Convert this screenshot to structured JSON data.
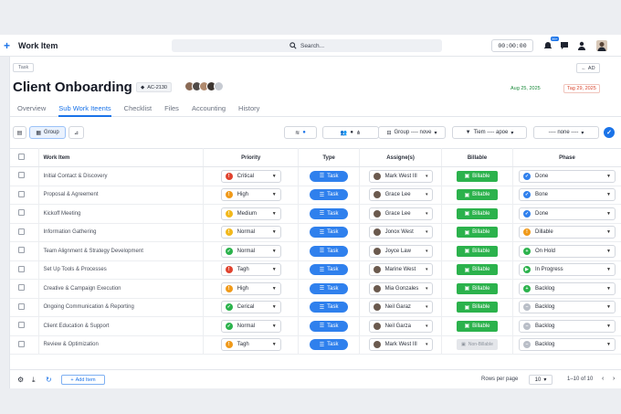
{
  "topbar": {
    "plus_label": "+",
    "title": "Work Item",
    "search_placeholder": "Search...",
    "timer": "00:00:00",
    "notification_badge": "99+"
  },
  "header": {
    "crumb": "Task",
    "title": "Client Onboarding",
    "id": "AC-2130",
    "ad_label": "AD",
    "start_date": "Aug 25, 2025",
    "end_date": "Tag 29, 2025"
  },
  "tabs": [
    {
      "label": "Overview"
    },
    {
      "label": "Sub Work Iteents"
    },
    {
      "label": "Checklist"
    },
    {
      "label": "Files"
    },
    {
      "label": "Accounting"
    },
    {
      "label": "History"
    }
  ],
  "toolbar": {
    "group_label": "Group",
    "group_filter": "Group ---- nove",
    "item_filter": "Tiem ---- apoe",
    "none_filter": "---- none ----"
  },
  "columns": {
    "work_item": "Work Item",
    "priority": "Priority",
    "type": "Type",
    "assignee": "Assigne(s)",
    "billable": "Billable",
    "phase": "Phase"
  },
  "rows": [
    {
      "item": "Initial Contact & Discovery",
      "priority": "Critical",
      "pcolor": "#e0432f",
      "picon": "!",
      "type": "Task",
      "assignee": "Mark West III",
      "billable": "Billable",
      "phase": "Done",
      "phcolor": "#2f80ed",
      "phicon": "✓"
    },
    {
      "item": "Proposal & Agreement",
      "priority": "High",
      "pcolor": "#f09a1a",
      "picon": "!",
      "type": "Task",
      "assignee": "Grace Lee",
      "billable": "Billable",
      "phase": "Bone",
      "phcolor": "#2f80ed",
      "phicon": "✓"
    },
    {
      "item": "Kickoff Meeting",
      "priority": "Medium",
      "pcolor": "#f2b81c",
      "picon": "!",
      "type": "Task",
      "assignee": "Grace Lee",
      "billable": "Billable",
      "phase": "Done",
      "phcolor": "#2f80ed",
      "phicon": "✓"
    },
    {
      "item": "Information Gathering",
      "priority": "Normal",
      "pcolor": "#f2b81c",
      "picon": "!",
      "type": "Task",
      "assignee": "Jonox West",
      "billable": "Billable",
      "phase": "Dillable",
      "phcolor": "#f09a1a",
      "phicon": "!"
    },
    {
      "item": "Team Alignment & Strategy Development",
      "priority": "Normal",
      "pcolor": "#2bb24c",
      "picon": "✓",
      "type": "Task",
      "assignee": "Joyce Law",
      "billable": "Billable",
      "phase": "On Hold",
      "phcolor": "#2bb24c",
      "phicon": "+"
    },
    {
      "item": "Set Up Tools & Processes",
      "priority": "Tagh",
      "pcolor": "#e0432f",
      "picon": "!",
      "type": "Task",
      "assignee": "Marine West",
      "billable": "Billable",
      "phase": "In Progress",
      "phcolor": "#2bb24c",
      "phicon": "▶"
    },
    {
      "item": "Creative & Campaign Execution",
      "priority": "High",
      "pcolor": "#f09a1a",
      "picon": "!",
      "type": "Task",
      "assignee": "Mia Gonzales",
      "billable": "Billable",
      "phase": "Backlog",
      "phcolor": "#2bb24c",
      "phicon": "+"
    },
    {
      "item": "Ongoing Communication & Reporting",
      "priority": "Cerical",
      "pcolor": "#2bb24c",
      "picon": "✓",
      "type": "Task",
      "assignee": "Neil Garaz",
      "billable": "Billable",
      "phase": "Backlog",
      "phcolor": "#b9bec7",
      "phicon": "–"
    },
    {
      "item": "Client Education & Support",
      "priority": "Normal",
      "pcolor": "#2bb24c",
      "picon": "✓",
      "type": "Task",
      "assignee": "Neil Garza",
      "billable": "Billable",
      "phase": "Backlog",
      "phcolor": "#b9bec7",
      "phicon": "–"
    },
    {
      "item": "Review & Optimization",
      "priority": "Tagh",
      "pcolor": "#f09a1a",
      "picon": "!",
      "type": "Task",
      "assignee": "Mark West III",
      "billable": "Non-Billable",
      "phase": "Backlog",
      "phcolor": "#b9bec7",
      "phicon": "–"
    }
  ],
  "footer": {
    "add_item": "Add Item",
    "rows_per_page_label": "Rows per page",
    "rows_per_page": "10",
    "range": "1–10 of 10"
  },
  "colors": {
    "accent": "#1a73e8",
    "billable_green": "#2bb24c",
    "task_blue": "#2f80ed"
  }
}
